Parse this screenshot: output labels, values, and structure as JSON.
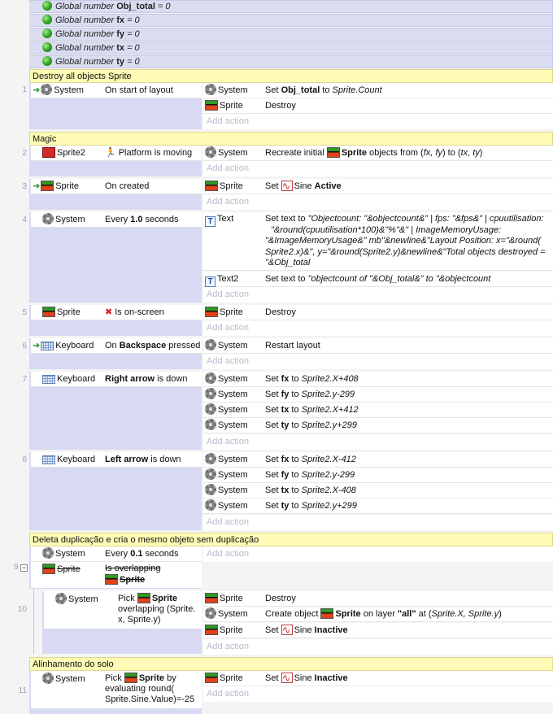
{
  "globals": [
    {
      "label": "Global number",
      "name": "Obj_total",
      "eq": "= 0"
    },
    {
      "label": "Global number",
      "name": "fx",
      "eq": "= 0"
    },
    {
      "label": "Global number",
      "name": "fy",
      "eq": "= 0"
    },
    {
      "label": "Global number",
      "name": "tx",
      "eq": "= 0"
    },
    {
      "label": "Global number",
      "name": "ty",
      "eq": "= 0"
    }
  ],
  "add_action": "Add action",
  "groups": {
    "g1": "Destroy all objects Sprite",
    "g2": "Magic",
    "g3": "Deleta duplicação e cria o mesmo objeto sem duplicação",
    "g4": "Alinhamento do solo"
  },
  "events": {
    "e1": {
      "num": "1",
      "cond_obj": "System",
      "cond_text": "On start of layout",
      "a1_obj": "System",
      "a1_pre": "Set ",
      "a1_b": "Obj_total",
      "a1_mid": " to ",
      "a1_i": "Sprite.Count",
      "a2_obj": "Sprite",
      "a2_text": "Destroy"
    },
    "e2": {
      "num": "2",
      "cond_obj": "Sprite2",
      "cond_text": "Platform is moving",
      "a1_obj": "System",
      "a1_pre": "Recreate initial ",
      "a1_b": "Sprite",
      "a1_mid": " objects from (",
      "a1_i1": "fx, fy",
      "a1_mid2": ") to (",
      "a1_i2": "tx, ty",
      "a1_end": ")"
    },
    "e3": {
      "num": "3",
      "cond_obj": "Sprite",
      "cond_text": "On created",
      "a1_obj": "Sprite",
      "a1_pre": "Set ",
      "a1_mid": "Sine ",
      "a1_b": "Active"
    },
    "e4": {
      "num": "4",
      "cond_obj": "System",
      "cond_pre": "Every ",
      "cond_b": "1.0",
      "cond_post": " seconds",
      "a1_obj": "Text",
      "a1_l1_pre": "Set text to ",
      "a1_l1_i": "\"Objectcount: \"&objectcount&\" | fps: \"&fps&\" | cpuutilisation:",
      "a1_l2": "\"&round(cpuutilisation*100)&\"%\"&\" | ImageMemoryUsage:",
      "a1_l3": "\"&ImageMemoryUsage&\" mb\"&newline&\"Layout Position: x=\"&round(",
      "a1_l4": "Sprite2.x)&\", y=\"&round(Sprite2.y)&newline&\"Total objects destroyed =",
      "a1_l5": "\"&Obj_total",
      "a2_obj": "Text2",
      "a2_pre": "Set text to ",
      "a2_i": "\"objectcount of \"&Obj_total&\" to \"&objectcount"
    },
    "e5": {
      "num": "5",
      "cond_obj": "Sprite",
      "cond_text": "Is on-screen",
      "a1_obj": "Sprite",
      "a1_text": "Destroy"
    },
    "e6": {
      "num": "6",
      "cond_obj": "Keyboard",
      "cond_pre": "On ",
      "cond_b": "Backspace",
      "cond_post": " pressed",
      "a1_obj": "System",
      "a1_text": "Restart layout"
    },
    "e7": {
      "num": "7",
      "cond_obj": "Keyboard",
      "cond_b": "Right arrow",
      "cond_post": " is down",
      "actions": [
        {
          "obj": "System",
          "pre": "Set ",
          "b": "fx",
          "mid": " to ",
          "i": "Sprite2.X+408"
        },
        {
          "obj": "System",
          "pre": "Set ",
          "b": "fy",
          "mid": " to ",
          "i": "Sprite2.y-299"
        },
        {
          "obj": "System",
          "pre": "Set ",
          "b": "tx",
          "mid": " to ",
          "i": "Sprite2.X+412"
        },
        {
          "obj": "System",
          "pre": "Set ",
          "b": "ty",
          "mid": " to ",
          "i": "Sprite2.y+299"
        }
      ]
    },
    "e8": {
      "num": "8",
      "cond_obj": "Keyboard",
      "cond_b": "Left arrow",
      "cond_post": " is down",
      "actions": [
        {
          "obj": "System",
          "pre": "Set ",
          "b": "fx",
          "mid": " to ",
          "i": "Sprite2.X-412"
        },
        {
          "obj": "System",
          "pre": "Set ",
          "b": "fy",
          "mid": " to ",
          "i": "Sprite2.y-299"
        },
        {
          "obj": "System",
          "pre": "Set ",
          "b": "tx",
          "mid": " to ",
          "i": "Sprite2.X-408"
        },
        {
          "obj": "System",
          "pre": "Set ",
          "b": "ty",
          "mid": " to ",
          "i": "Sprite2.y+299"
        }
      ]
    },
    "e9": {
      "num": "9",
      "c1_obj": "System",
      "c1_pre": "Every ",
      "c1_b": "0.1",
      "c1_post": " seconds",
      "c2_obj": "Sprite",
      "c2_l1": "Is overlapping",
      "c2_l2": "Sprite"
    },
    "e10": {
      "num": "10",
      "cond_obj": "System",
      "cond_l1_pre": "Pick ",
      "cond_l1_b": "Sprite",
      "cond_l2": "overlapping (Sprite.",
      "cond_l3": "x, Sprite.y)",
      "a1_obj": "Sprite",
      "a1_text": "Destroy",
      "a2_obj": "System",
      "a2_pre": "Create object ",
      "a2_b": "Sprite",
      "a2_mid": " on layer ",
      "a2_b2": "\"all\"",
      "a2_mid2": " at (",
      "a2_i": "Sprite.X, Sprite.y",
      "a2_end": ")",
      "a3_obj": "Sprite",
      "a3_pre": "Set ",
      "a3_mid": "Sine ",
      "a3_b": "Inactive"
    },
    "e11": {
      "num": "11",
      "cond_obj": "System",
      "cond_l1_pre": "Pick ",
      "cond_l1_b": "Sprite",
      "cond_l1_post": " by",
      "cond_l2": "evaluating round(",
      "cond_l3": "Sprite.Sine.Value)=-25",
      "a1_obj": "Sprite",
      "a1_pre": "Set ",
      "a1_mid": "Sine ",
      "a1_b": "Inactive"
    }
  },
  "colors": {
    "group_bg": "#fffbb6",
    "event_bg": "#d8d9f2",
    "global_bg": "#dadcf0",
    "add_action": "#b8bccd"
  }
}
